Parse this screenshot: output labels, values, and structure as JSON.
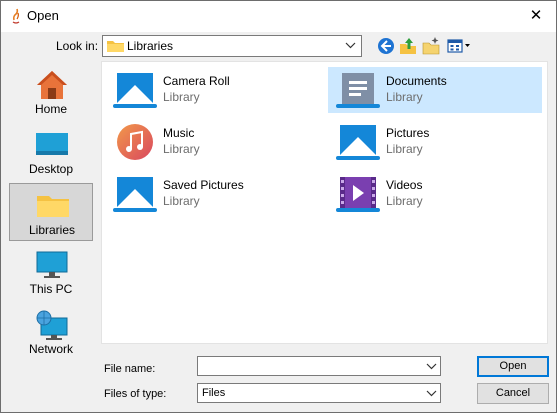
{
  "window": {
    "title": "Open"
  },
  "lookin": {
    "label": "Look in:",
    "value": "Libraries"
  },
  "toolbar": {
    "back_icon": "back-arrow-icon",
    "up_icon": "up-folder-icon",
    "new_folder_icon": "new-folder-icon",
    "view_icon": "view-menu-icon"
  },
  "places": [
    {
      "label": "Home"
    },
    {
      "label": "Desktop"
    },
    {
      "label": "Libraries",
      "selected": true
    },
    {
      "label": "This PC"
    },
    {
      "label": "Network"
    }
  ],
  "items": [
    {
      "name": "Camera Roll",
      "type": "Library",
      "icon": "camera-roll-library-icon"
    },
    {
      "name": "Documents",
      "type": "Library",
      "icon": "documents-library-icon",
      "selected": true
    },
    {
      "name": "Music",
      "type": "Library",
      "icon": "music-library-icon"
    },
    {
      "name": "Pictures",
      "type": "Library",
      "icon": "pictures-library-icon"
    },
    {
      "name": "Saved Pictures",
      "type": "Library",
      "icon": "saved-pictures-library-icon"
    },
    {
      "name": "Videos",
      "type": "Library",
      "icon": "videos-library-icon"
    }
  ],
  "filename": {
    "label": "File name:",
    "value": ""
  },
  "filetype": {
    "label": "Files of type:",
    "value": "Files"
  },
  "buttons": {
    "open": "Open",
    "cancel": "Cancel"
  },
  "colors": {
    "selection": "#cce8ff",
    "accent": "#0078d7",
    "dialog_bg": "#f0f0f0"
  }
}
